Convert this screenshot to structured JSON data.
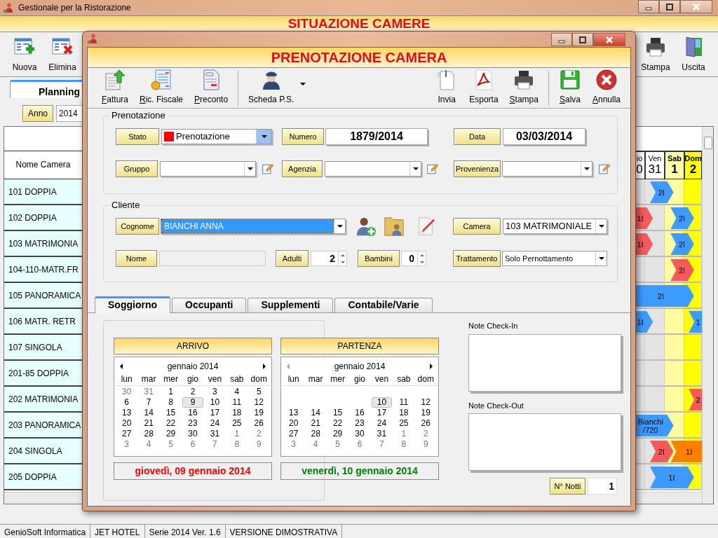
{
  "app_window": {
    "title": "Gestionale per la Ristorazione",
    "header": "SITUAZIONE CAMERE",
    "toolbar_left": [
      {
        "label": "Nuova",
        "kind": "new"
      },
      {
        "label": "Elimina",
        "kind": "delete"
      }
    ],
    "toolbar_right": [
      {
        "label": "Stampa",
        "kind": "print"
      },
      {
        "label": "Uscita",
        "kind": "exit"
      }
    ],
    "tabs": [
      {
        "label": "Planning",
        "selected": true
      }
    ],
    "year": {
      "label": "Anno",
      "value": "2014"
    },
    "planning": {
      "room_header": "Nome Camera",
      "days": [
        {
          "weekday": "io",
          "day": "0",
          "kind": "weekday"
        },
        {
          "weekday": "Ven",
          "day": "31",
          "kind": "weekday"
        },
        {
          "weekday": "Sab",
          "day": "1",
          "kind": "saturday"
        },
        {
          "weekday": "Dom",
          "day": "2",
          "kind": "sunday"
        }
      ],
      "rows": [
        {
          "room": "101 DOPPIA",
          "bars": [
            {
              "label": "2I",
              "color": "#3d9bff"
            }
          ]
        },
        {
          "room": "102 DOPPIA",
          "bars": [
            {
              "label": "1I",
              "color": "#f55a5a"
            },
            {
              "label": "2I",
              "color": "#3d9bff"
            }
          ]
        },
        {
          "room": "103 MATRIMONIA",
          "bars": [
            {
              "label": "1I",
              "color": "#f55a5a"
            },
            {
              "label": "2I",
              "color": "#3d9bff"
            }
          ]
        },
        {
          "room": "104-110-MATR.FR",
          "bars": [
            {
              "label": "2I",
              "color": "#f55a5a"
            }
          ]
        },
        {
          "room": "105 PANORAMICA",
          "bars": [
            {
              "label": "2I",
              "color": "#3d9bff"
            }
          ]
        },
        {
          "room": "106 MATR. RETR",
          "bars": [
            {
              "label": "1I",
              "color": "#3d9bff"
            },
            {
              "label": "1",
              "color": "#3d9bff"
            }
          ]
        },
        {
          "room": "107 SINGOLA"
        },
        {
          "room": "201-85 DOPPIA"
        },
        {
          "room": "202 MATRIMONIA",
          "bars": [
            {
              "label": "2",
              "color": "#f55a5a"
            }
          ]
        },
        {
          "room": "203 PANORAMICA",
          "bars": [
            {
              "label": "Bianchi /720",
              "color": "#3d9bff"
            }
          ]
        },
        {
          "room": "204 SINGOLA",
          "bars": [
            {
              "label": "2I",
              "color": "#f55a5a"
            },
            {
              "label": "1I",
              "color": "#ff8000"
            }
          ]
        },
        {
          "room": "205 DOPPIA",
          "bars": [
            {
              "label": "1I",
              "color": "#3d9bff"
            }
          ]
        }
      ]
    }
  },
  "dialog": {
    "header": "PRENOTAZIONE CAMERA",
    "toolbar_left": [
      {
        "label": "Fattura",
        "kind": "invoice",
        "mnemonic": true,
        "dropdown": false
      },
      {
        "label": "Ric. Fiscale",
        "kind": "receipt",
        "mnemonic": true,
        "dropdown": false
      },
      {
        "label": "Preconto",
        "kind": "bill",
        "mnemonic": true,
        "dropdown": false
      },
      {
        "label": "Scheda P.S.",
        "kind": "officer",
        "mnemonic": false,
        "dropdown": true
      }
    ],
    "toolbar_right": [
      {
        "label": "Invia",
        "kind": "send",
        "mnemonic": false
      },
      {
        "label": "Esporta",
        "kind": "pdf",
        "mnemonic": false
      },
      {
        "label": "Stampa",
        "kind": "print",
        "mnemonic": true
      }
    ],
    "toolbar_actions": [
      {
        "label": "Salva",
        "kind": "save",
        "mnemonic": true
      },
      {
        "label": "Annulla",
        "kind": "cancel",
        "mnemonic": true
      }
    ],
    "prenotazione": {
      "title": "Prenotazione",
      "stato": {
        "label": "Stato",
        "value": "Prenotazione",
        "color": "#ff0000"
      },
      "numero": {
        "label": "Numero",
        "value": "1879/2014"
      },
      "data": {
        "label": "Data",
        "value": "03/03/2014"
      },
      "gruppo": {
        "label": "Gruppo"
      },
      "agenzia": {
        "label": "Agenzia"
      },
      "provenienza": {
        "label": "Provenienza"
      }
    },
    "cliente": {
      "title": "Cliente",
      "cognome": {
        "label": "Cognome",
        "value": "BIANCHI ANNA",
        "selected": true
      },
      "camera": {
        "label": "Camera",
        "value": "103 MATRIMONIALE"
      },
      "nome": {
        "label": "Nome",
        "disabled": true
      },
      "adulti": {
        "label": "Adulti",
        "value": "2"
      },
      "bambini": {
        "label": "Bambini",
        "value": "0"
      },
      "trattamento": {
        "label": "Trattamento",
        "value": "Solo Pernottamento"
      }
    },
    "tabs": [
      {
        "label": "Soggiorno",
        "selected": true
      },
      {
        "label": "Occupanti",
        "selected": false
      },
      {
        "label": "Supplementi",
        "selected": false
      },
      {
        "label": "Contabile/Varie",
        "selected": false
      }
    ],
    "calendars": [
      {
        "kind": "arrival",
        "title": "ARRIVO",
        "month": "gennaio 2014",
        "prev_enabled": true,
        "weekdays": [
          "lun",
          "mar",
          "mer",
          "gio",
          "ven",
          "sab",
          "dom"
        ],
        "date_text": "giovedì, 09 gennaio 2014",
        "weeks": [
          [
            {
              "day": "30",
              "muted": true,
              "selected": false
            },
            {
              "day": "31",
              "muted": true,
              "selected": false
            },
            {
              "day": "1",
              "muted": false,
              "selected": false
            },
            {
              "day": "2",
              "muted": false,
              "selected": false
            },
            {
              "day": "3",
              "muted": false,
              "selected": false
            },
            {
              "day": "4",
              "muted": false,
              "selected": false
            },
            {
              "day": "5",
              "muted": false,
              "selected": false
            }
          ],
          [
            {
              "day": "6",
              "muted": false,
              "selected": false
            },
            {
              "day": "7",
              "muted": false,
              "selected": false
            },
            {
              "day": "8",
              "muted": false,
              "selected": false
            },
            {
              "day": "9",
              "muted": false,
              "selected": true
            },
            {
              "day": "10",
              "muted": false,
              "selected": false
            },
            {
              "day": "11",
              "muted": false,
              "selected": false
            },
            {
              "day": "12",
              "muted": false,
              "selected": false
            }
          ],
          [
            {
              "day": "13",
              "muted": false,
              "selected": false
            },
            {
              "day": "14",
              "muted": false,
              "selected": false
            },
            {
              "day": "15",
              "muted": false,
              "selected": false
            },
            {
              "day": "16",
              "muted": false,
              "selected": false
            },
            {
              "day": "17",
              "muted": false,
              "selected": false
            },
            {
              "day": "18",
              "muted": false,
              "selected": false
            },
            {
              "day": "19",
              "muted": false,
              "selected": false
            }
          ],
          [
            {
              "day": "20",
              "muted": false,
              "selected": false
            },
            {
              "day": "21",
              "muted": false,
              "selected": false
            },
            {
              "day": "22",
              "muted": false,
              "selected": false
            },
            {
              "day": "23",
              "muted": false,
              "selected": false
            },
            {
              "day": "24",
              "muted": false,
              "selected": false
            },
            {
              "day": "25",
              "muted": false,
              "selected": false
            },
            {
              "day": "26",
              "muted": false,
              "selected": false
            }
          ],
          [
            {
              "day": "27",
              "muted": false,
              "selected": false
            },
            {
              "day": "28",
              "muted": false,
              "selected": false
            },
            {
              "day": "29",
              "muted": false,
              "selected": false
            },
            {
              "day": "30",
              "muted": false,
              "selected": false
            },
            {
              "day": "31",
              "muted": false,
              "selected": false
            },
            {
              "day": "1",
              "muted": true,
              "selected": false
            },
            {
              "day": "2",
              "muted": true,
              "selected": false
            }
          ],
          [
            {
              "day": "3",
              "muted": true,
              "selected": false
            },
            {
              "day": "4",
              "muted": true,
              "selected": false
            },
            {
              "day": "5",
              "muted": true,
              "selected": false
            },
            {
              "day": "6",
              "muted": true,
              "selected": false
            },
            {
              "day": "7",
              "muted": true,
              "selected": false
            },
            {
              "day": "8",
              "muted": true,
              "selected": false
            },
            {
              "day": "9",
              "muted": true,
              "selected": false
            }
          ]
        ]
      },
      {
        "kind": "departure",
        "title": "PARTENZA",
        "month": "gennaio 2014",
        "prev_enabled": false,
        "weekdays": [
          "lun",
          "mar",
          "mer",
          "gio",
          "ven",
          "sab",
          "dom"
        ],
        "date_text": "venerdì, 10 gennaio 2014",
        "weeks": [
          [
            {
              "day": "10",
              "muted": false,
              "selected": true
            },
            {
              "day": "11",
              "muted": false,
              "selected": false
            },
            {
              "day": "12",
              "muted": false,
              "selected": false
            }
          ],
          [
            {
              "day": "13",
              "muted": false,
              "selected": false
            },
            {
              "day": "14",
              "muted": false,
              "selected": false
            },
            {
              "day": "15",
              "muted": false,
              "selected": false
            },
            {
              "day": "16",
              "muted": false,
              "selected": false
            },
            {
              "day": "17",
              "muted": false,
              "selected": false
            },
            {
              "day": "18",
              "muted": false,
              "selected": false
            },
            {
              "day": "19",
              "muted": false,
              "selected": false
            }
          ],
          [
            {
              "day": "20",
              "muted": false,
              "selected": false
            },
            {
              "day": "21",
              "muted": false,
              "selected": false
            },
            {
              "day": "22",
              "muted": false,
              "selected": false
            },
            {
              "day": "23",
              "muted": false,
              "selected": false
            },
            {
              "day": "24",
              "muted": false,
              "selected": false
            },
            {
              "day": "25",
              "muted": false,
              "selected": false
            },
            {
              "day": "26",
              "muted": false,
              "selected": false
            }
          ],
          [
            {
              "day": "27",
              "muted": false,
              "selected": false
            },
            {
              "day": "28",
              "muted": false,
              "selected": false
            },
            {
              "day": "29",
              "muted": false,
              "selected": false
            },
            {
              "day": "30",
              "muted": false,
              "selected": false
            },
            {
              "day": "31",
              "muted": false,
              "selected": false
            },
            {
              "day": "1",
              "muted": true,
              "selected": false
            },
            {
              "day": "2",
              "muted": true,
              "selected": false
            }
          ],
          [
            {
              "day": "3",
              "muted": true,
              "selected": false
            },
            {
              "day": "4",
              "muted": true,
              "selected": false
            },
            {
              "day": "5",
              "muted": true,
              "selected": false
            },
            {
              "day": "6",
              "muted": true,
              "selected": false
            },
            {
              "day": "7",
              "muted": true,
              "selected": false
            },
            {
              "day": "8",
              "muted": true,
              "selected": false
            },
            {
              "day": "9",
              "muted": true,
              "selected": false
            }
          ]
        ]
      }
    ],
    "notes": [
      {
        "label": "Note Check-In"
      },
      {
        "label": "Note Check-Out"
      }
    ],
    "nights": {
      "label": "N° Notti",
      "value": "1"
    }
  },
  "status_bar": [
    "GenioSoft Informatica",
    "JET HOTEL",
    "Serie 2014 Ver. 1.6",
    "VERSIONE DIMOSTRATIVA"
  ]
}
